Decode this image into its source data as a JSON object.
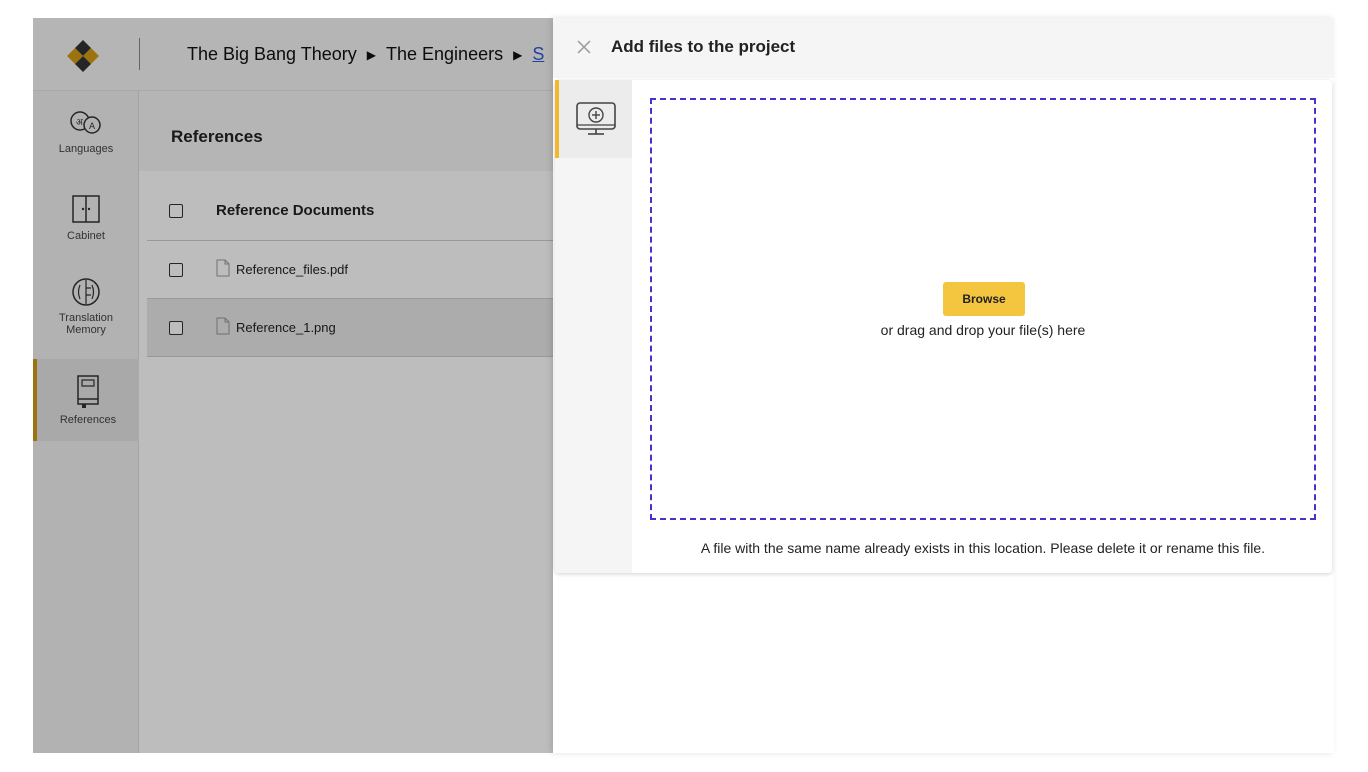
{
  "breadcrumb": {
    "items": [
      "The Big Bang Theory",
      "The Engineers"
    ],
    "current": "S"
  },
  "sidebar": {
    "items": [
      {
        "label": "Languages",
        "icon": "languages-icon"
      },
      {
        "label": "Cabinet",
        "icon": "cabinet-icon"
      },
      {
        "label": "Translation\nMemory",
        "icon": "translation-memory-icon"
      },
      {
        "label": "References",
        "icon": "references-icon",
        "active": true
      }
    ]
  },
  "content": {
    "title": "References",
    "table_header": "Reference Documents",
    "files": [
      {
        "name": "Reference_files.pdf"
      },
      {
        "name": "Reference_1.png"
      }
    ]
  },
  "panel": {
    "title": "Add files to the project",
    "tab_icon": "add-from-computer-icon",
    "browse_label": "Browse",
    "drag_text": "or drag and drop your file(s) here",
    "error_message": "A file with the same name already exists in this location. Please delete it or rename this file."
  },
  "colors": {
    "accent": "#f2b92e",
    "browse": "#f4c53e",
    "dropzone_border": "#4433cc",
    "sidebar_active": "#d49b15",
    "link": "#2a5bd7"
  }
}
